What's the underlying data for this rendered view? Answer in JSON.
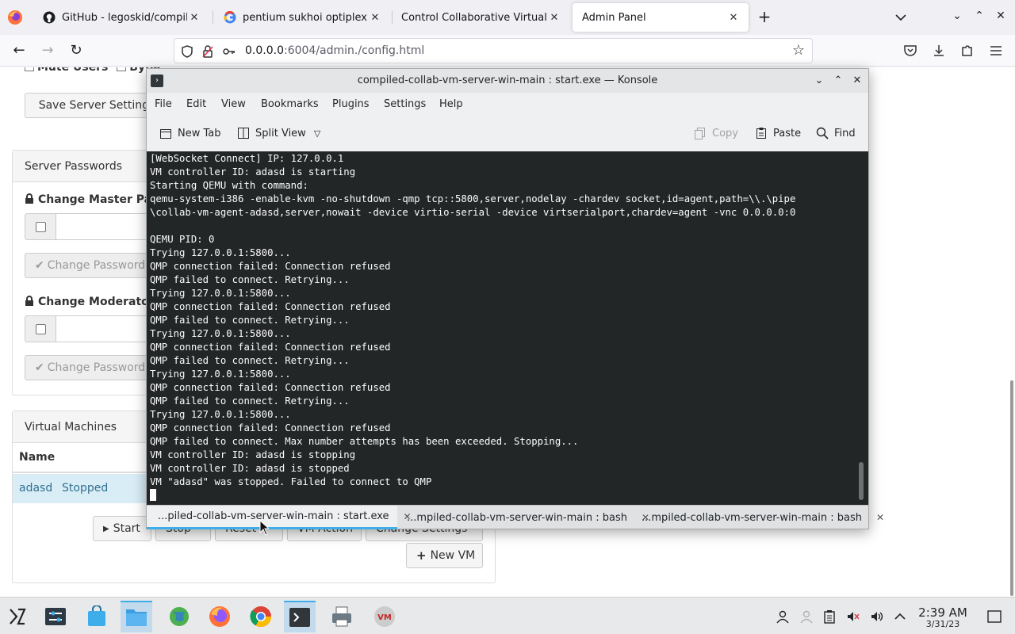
{
  "browser": {
    "tabs": [
      {
        "title": "GitHub - legoskid/compiled-collab-vm-server",
        "icon": "github-icon"
      },
      {
        "title": "pentium sukhoi optiplex - Google Search",
        "icon": "google-icon"
      },
      {
        "title": "Control Collaborative Virtual Machines",
        "icon": "none"
      },
      {
        "title": "Admin Panel",
        "icon": "none",
        "active": true
      }
    ],
    "url_host": "0.0.0.0",
    "url_path": ":6004/admin./config.html"
  },
  "page": {
    "top_checkboxes": {
      "mute_users": "Mute Users",
      "bypass": "Bypa"
    },
    "save_button": "Save Server Setting",
    "server_passwords": {
      "heading": "Server Passwords",
      "master_label": "Change Master Pass",
      "moderator_label": "Change Moderator P",
      "change_password": "Change Password"
    },
    "virtual_machines": {
      "heading": "Virtual Machines",
      "col_name": "Name",
      "rows": [
        {
          "name": "adasd",
          "status": "Stopped"
        }
      ],
      "start": "Start",
      "stop": "Stop",
      "reset": "Reset",
      "vm_action": "VM Action",
      "change_settings": "Change Settings",
      "new_vm": "New VM"
    }
  },
  "konsole": {
    "title": "compiled-collab-vm-server-win-main : start.exe — Konsole",
    "menu": [
      "File",
      "Edit",
      "View",
      "Bookmarks",
      "Plugins",
      "Settings",
      "Help"
    ],
    "toolbar": {
      "new_tab": "New Tab",
      "split_view": "Split View",
      "copy": "Copy",
      "paste": "Paste",
      "find": "Find"
    },
    "lines": [
      "[WebSocket Connect] IP: 127.0.0.1",
      "VM controller ID: adasd is starting",
      "Starting QEMU with command:",
      "qemu-system-i386 -enable-kvm -no-shutdown -qmp tcp::5800,server,nodelay -chardev socket,id=agent,path=\\\\.\\pipe",
      "\\collab-vm-agent-adasd,server,nowait -device virtio-serial -device virtserialport,chardev=agent -vnc 0.0.0.0:0",
      "",
      "QEMU PID: 0",
      "Trying 127.0.0.1:5800...",
      "QMP connection failed: Connection refused",
      "QMP failed to connect. Retrying...",
      "Trying 127.0.0.1:5800...",
      "QMP connection failed: Connection refused",
      "QMP failed to connect. Retrying...",
      "Trying 127.0.0.1:5800...",
      "QMP connection failed: Connection refused",
      "QMP failed to connect. Retrying...",
      "Trying 127.0.0.1:5800...",
      "QMP connection failed: Connection refused",
      "QMP failed to connect. Retrying...",
      "Trying 127.0.0.1:5800...",
      "QMP connection failed: Connection refused",
      "QMP failed to connect. Max number attempts has been exceeded. Stopping...",
      "VM controller ID: adasd is stopping",
      "VM controller ID: adasd is stopped",
      "VM \"adasd\" was stopped. Failed to connect to QMP"
    ],
    "tabs": [
      {
        "label": "...piled-collab-vm-server-win-main : start.exe",
        "active": true
      },
      {
        "label": "...mpiled-collab-vm-server-win-main : bash"
      },
      {
        "label": "...mpiled-collab-vm-server-win-main : bash"
      }
    ]
  },
  "taskbar": {
    "clock_time": "2:39 AM",
    "clock_date": "3/31/23",
    "apps": [
      "app-launcher-icon",
      "system-settings-icon",
      "discover-store-icon",
      "file-manager-icon",
      "globe-icon",
      "firefox-icon",
      "chrome-icon",
      "konsole-icon",
      "printer-icon",
      "virt-manager-icon"
    ]
  },
  "colors": {
    "terminal_bg": "#232627",
    "terminal_fg": "#fcfcfc",
    "accent": "#3daee9"
  }
}
